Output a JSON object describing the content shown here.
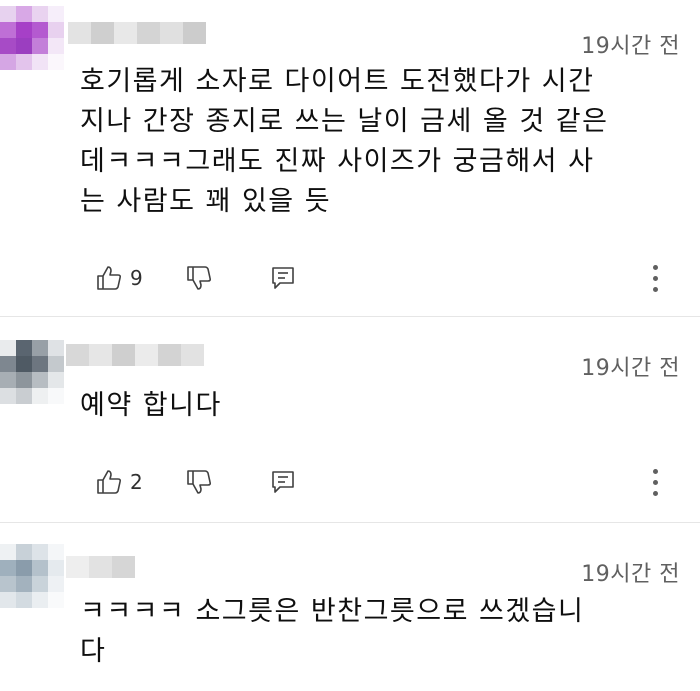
{
  "comments": [
    {
      "timestamp": "19시간 전",
      "text_lines": [
        "호기롭게 소자로 다이어트 도전했다가 시간",
        "지나 간장 종지로 쓰는 날이 금세 올 것 같은",
        "데ㅋㅋㅋ그래도 진짜 사이즈가 궁금해서 사",
        "는 사람도 꽤 있을 듯"
      ],
      "like_count": "9"
    },
    {
      "timestamp": "19시간 전",
      "text_lines": [
        "예약 합니다"
      ],
      "like_count": "2"
    },
    {
      "timestamp": "19시간 전",
      "text_lines": [
        "ㅋㅋㅋㅋ 소그릇은 반찬그릇으로 쓰겠습니",
        "다"
      ]
    }
  ],
  "icons": {
    "like": "thumbs-up-icon",
    "dislike": "thumbs-down-icon",
    "reply": "reply-icon",
    "more": "more-vert-icon"
  },
  "colors": {
    "avatar1": [
      "#c27ad6",
      "#a24fc0",
      "#d9b5e6"
    ],
    "avatar2": [
      "#5a6570",
      "#8c939a",
      "#c9cdd1"
    ],
    "avatar3": [
      "#8fa0ae",
      "#b8c4cd",
      "#dde3e8"
    ],
    "text": "#0f0f0f",
    "timestamp": "#606060"
  }
}
